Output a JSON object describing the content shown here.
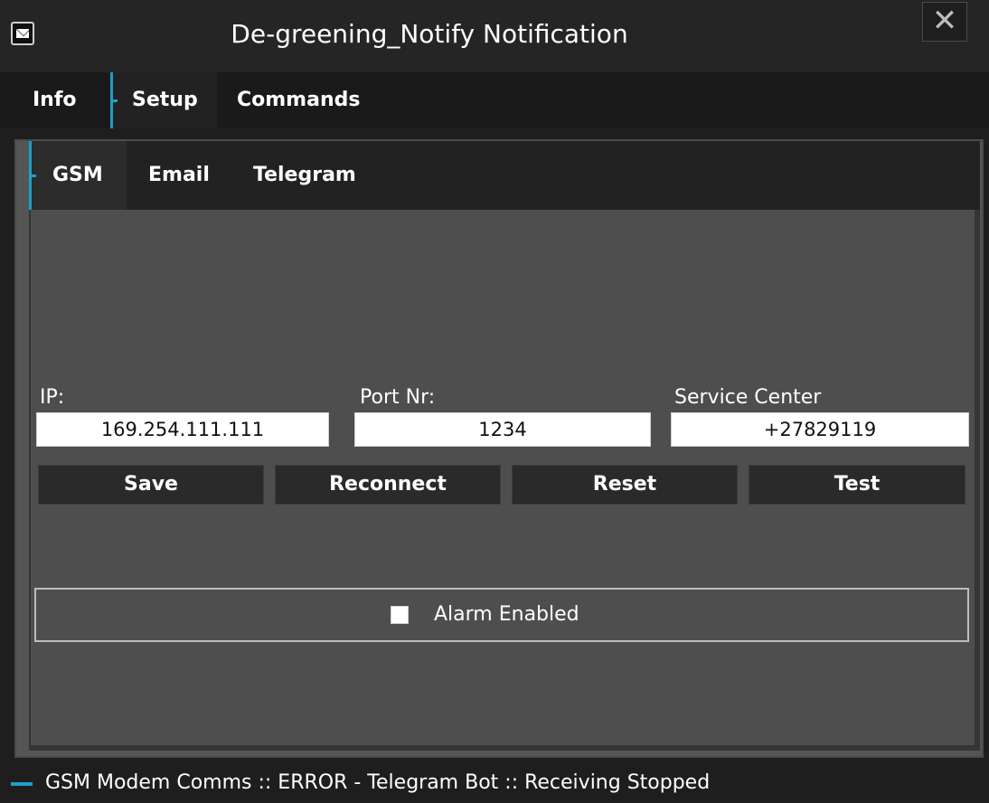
{
  "window": {
    "title": "De-greening_Notify Notification",
    "close_label": "✕"
  },
  "main_tabs": [
    {
      "label": "Info",
      "active": false
    },
    {
      "label": "Setup",
      "active": true
    },
    {
      "label": "Commands",
      "active": false
    }
  ],
  "sub_tabs": [
    {
      "label": "GSM",
      "active": true
    },
    {
      "label": "Email",
      "active": false
    },
    {
      "label": "Telegram",
      "active": false
    }
  ],
  "gsm": {
    "ip": {
      "label": "IP:",
      "value": "169.254.111.111"
    },
    "port": {
      "label": "Port Nr:",
      "value": "1234"
    },
    "service_center": {
      "label": "Service Center",
      "value": "+27829119"
    },
    "buttons": {
      "save": "Save",
      "reconnect": "Reconnect",
      "reset": "Reset",
      "test": "Test"
    },
    "alarm": {
      "label": "Alarm Enabled",
      "checked": false
    }
  },
  "status": {
    "text": "GSM Modem Comms :: ERROR - Telegram Bot :: Receiving Stopped"
  },
  "colors": {
    "accent": "#1ea0c8",
    "background": "#1e1e1e",
    "panel": "#4e4e4e"
  }
}
